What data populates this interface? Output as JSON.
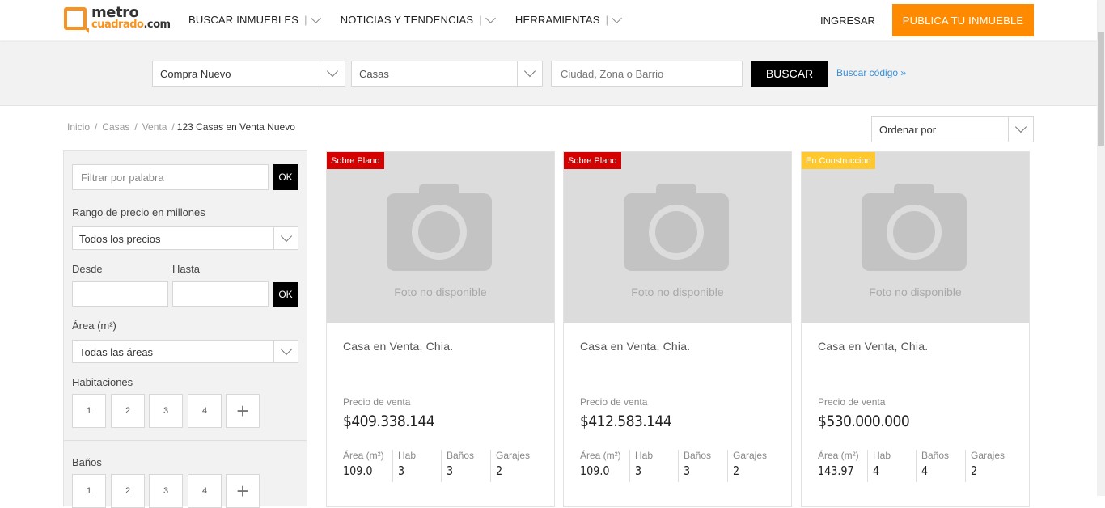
{
  "header": {
    "logo_top": "metro",
    "logo_bottom_a": "cuadrado",
    "logo_bottom_b": ".com",
    "nav": [
      "BUSCAR INMUEBLES",
      "NOTICIAS Y TENDENCIAS",
      "HERRAMIENTAS"
    ],
    "login": "INGRESAR",
    "publish": "PUBLICA TU INMUEBLE",
    "accent_color": "#ff8a00"
  },
  "search": {
    "operation": "Compra Nuevo",
    "property_type": "Casas",
    "location_placeholder": "Ciudad, Zona o Barrio",
    "button": "BUSCAR",
    "code_link": "Buscar código »"
  },
  "breadcrumb": {
    "items": [
      "Inicio",
      "/",
      "Casas",
      "/",
      "Venta",
      "/"
    ],
    "current": "123  Casas en Venta Nuevo"
  },
  "sort": {
    "label": "Ordenar por"
  },
  "filters": {
    "keyword_placeholder": "Filtrar por palabra",
    "ok": "OK",
    "price_range_label": "Rango de precio en millones",
    "price_select": "Todos los precios",
    "from_label": "Desde",
    "to_label": "Hasta",
    "area_label": "Área (m²)",
    "area_select": "Todas las áreas",
    "rooms_label": "Habitaciones",
    "rooms": [
      "1",
      "2",
      "3",
      "4"
    ],
    "baths_label": "Baños",
    "baths": [
      "1",
      "2",
      "3",
      "4"
    ]
  },
  "listings": [
    {
      "badge": "Sobre Plano",
      "badge_color": "#d50000",
      "no_photo": "Foto no disponible",
      "title": "Casa en Venta, Chia.",
      "price_label": "Precio de venta",
      "price": "$409.338.144",
      "area_label": "Área (m²)",
      "area": "109.0",
      "rooms_label": "Hab",
      "rooms": "3",
      "baths_label": "Baños",
      "baths": "3",
      "garages_label": "Garajes",
      "garages": "2"
    },
    {
      "badge": "Sobre Plano",
      "badge_color": "#d50000",
      "no_photo": "Foto no disponible",
      "title": "Casa en Venta, Chia.",
      "price_label": "Precio de venta",
      "price": "$412.583.144",
      "area_label": "Área (m²)",
      "area": "109.0",
      "rooms_label": "Hab",
      "rooms": "3",
      "baths_label": "Baños",
      "baths": "3",
      "garages_label": "Garajes",
      "garages": "2"
    },
    {
      "badge": "En Construccion",
      "badge_color": "#ffc92e",
      "no_photo": "Foto no disponible",
      "title": "Casa en Venta, Chia.",
      "price_label": "Precio de venta",
      "price": "$530.000.000",
      "area_label": "Área (m²)",
      "area": "143.97",
      "rooms_label": "Hab",
      "rooms": "4",
      "baths_label": "Baños",
      "baths": "4",
      "garages_label": "Garajes",
      "garages": "2"
    }
  ]
}
